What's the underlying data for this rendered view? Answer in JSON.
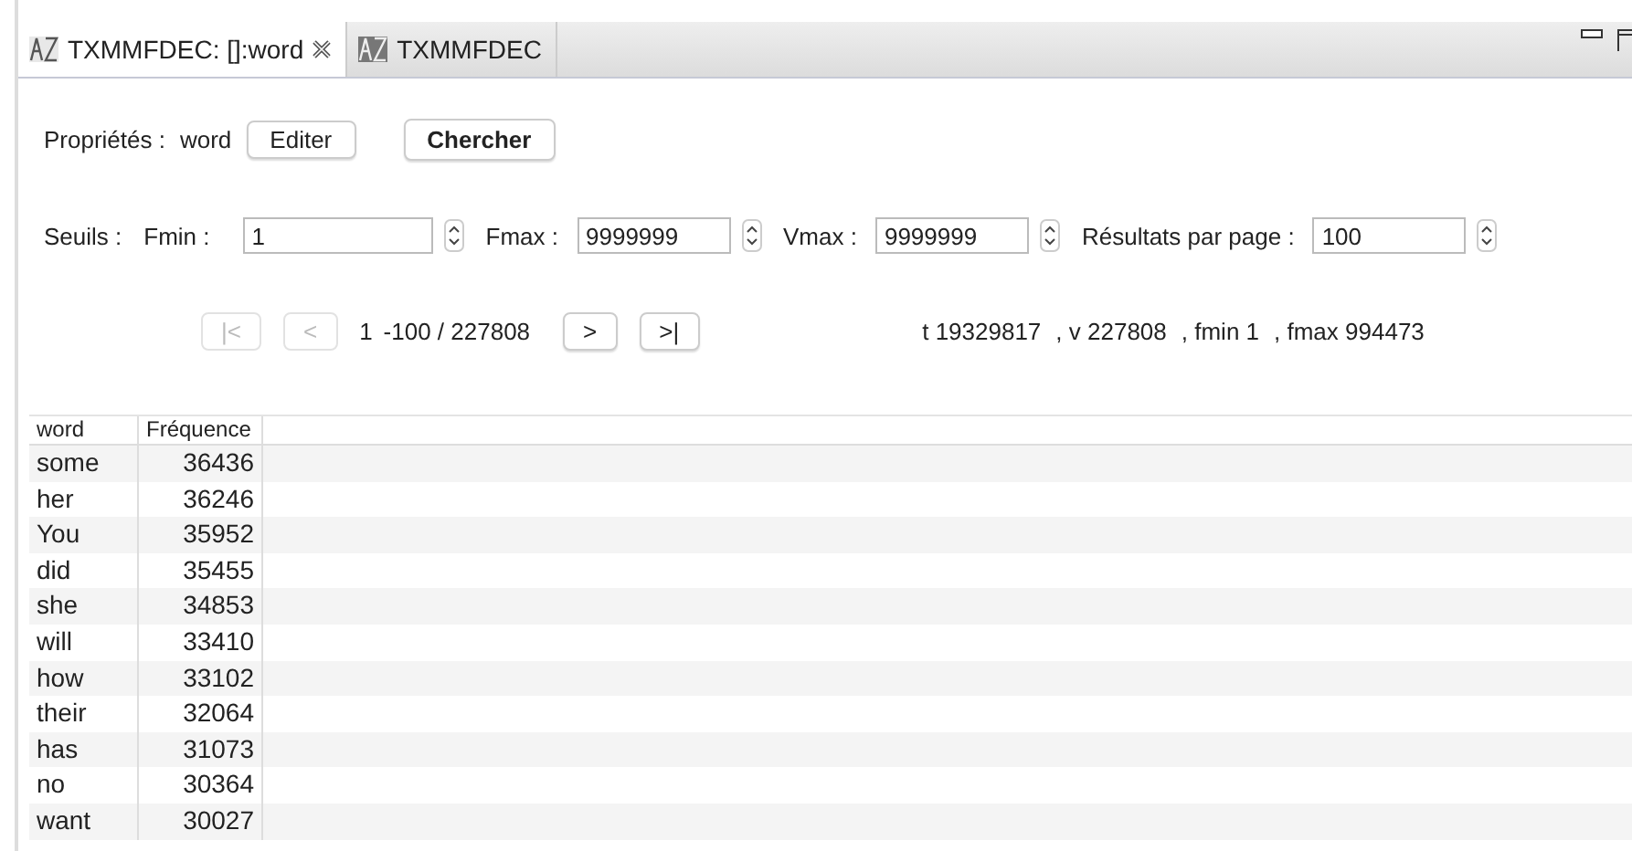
{
  "tabs": [
    {
      "label": "TXMMFDEC: []:word",
      "selected": true,
      "closable": true
    },
    {
      "label": "TXMMFDEC",
      "selected": false,
      "closable": false
    }
  ],
  "properties": {
    "label": "Propriétés :",
    "value": "word",
    "buttons": [
      {
        "label": "Editer",
        "bold": false
      },
      {
        "label": "Chercher",
        "bold": true
      }
    ]
  },
  "thresholds": {
    "label": "Seuils :",
    "fields": [
      {
        "label": "Fmin :",
        "value": "1",
        "wide": true
      },
      {
        "label": "Fmax :",
        "value": "9999999",
        "wide": false
      },
      {
        "label": "Vmax :",
        "value": "9999999",
        "wide": false
      },
      {
        "label": "Résultats par page :",
        "value": "100",
        "wide": false
      }
    ]
  },
  "pager": {
    "buttons": [
      {
        "label": "|<",
        "disabled": true
      },
      {
        "label": "<",
        "disabled": true
      },
      {
        "label": ">",
        "disabled": false
      },
      {
        "label": ">|",
        "disabled": false
      }
    ],
    "start": "1",
    "range": "-100 / 227808",
    "stats": [
      "t 19329817",
      ", v 227808",
      ", fmin 1",
      ", fmax 994473"
    ]
  },
  "table": {
    "columns": [
      "word",
      "Fréquence"
    ],
    "rows": [
      [
        "some",
        "36436"
      ],
      [
        "her",
        "36246"
      ],
      [
        "You",
        "35952"
      ],
      [
        "did",
        "35455"
      ],
      [
        "she",
        "34853"
      ],
      [
        "will",
        "33410"
      ],
      [
        "how",
        "33102"
      ],
      [
        "their",
        "32064"
      ],
      [
        "has",
        "31073"
      ],
      [
        "no",
        "30364"
      ],
      [
        "want",
        "30027"
      ]
    ]
  }
}
